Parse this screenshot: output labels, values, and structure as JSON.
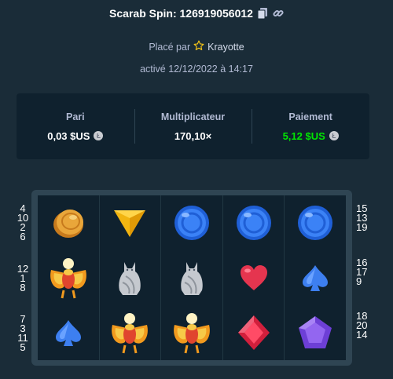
{
  "header": {
    "title": "Scarab Spin: 126919056012"
  },
  "placed": {
    "prefix": "Placé par",
    "user": "Krayotte"
  },
  "date": "activé 12/12/2022 à 14:17",
  "stats": {
    "bet": {
      "label": "Pari",
      "value": "0,03 $US"
    },
    "multiplier": {
      "label": "Multiplicateur",
      "value": "170,10×"
    },
    "payout": {
      "label": "Paiement",
      "value": "5,12 $US"
    }
  },
  "colors": {
    "background": "#1a2c38",
    "panel": "#0f212e",
    "frame": "#2f4553",
    "payout": "#00e701"
  },
  "paylines": {
    "left": [
      [
        "4",
        "10",
        "2",
        "6"
      ],
      [
        "12",
        "1",
        "8"
      ],
      [
        "7",
        "3",
        "11",
        "5"
      ]
    ],
    "right": [
      [
        "15",
        "13",
        "19"
      ],
      [
        "16",
        "17",
        "9"
      ],
      [
        "18",
        "20",
        "14"
      ]
    ]
  },
  "reels": [
    [
      "coin-icon",
      "scarab-icon",
      "spade-icon"
    ],
    [
      "triangle-gem-icon",
      "cat-statue-icon",
      "scarab-icon"
    ],
    [
      "blue-circle-gem-icon",
      "cat-statue-icon",
      "scarab-icon"
    ],
    [
      "blue-circle-gem-icon",
      "heart-icon",
      "red-diamond-icon"
    ],
    [
      "blue-circle-gem-icon",
      "spade-icon",
      "purple-pentagon-icon"
    ]
  ]
}
